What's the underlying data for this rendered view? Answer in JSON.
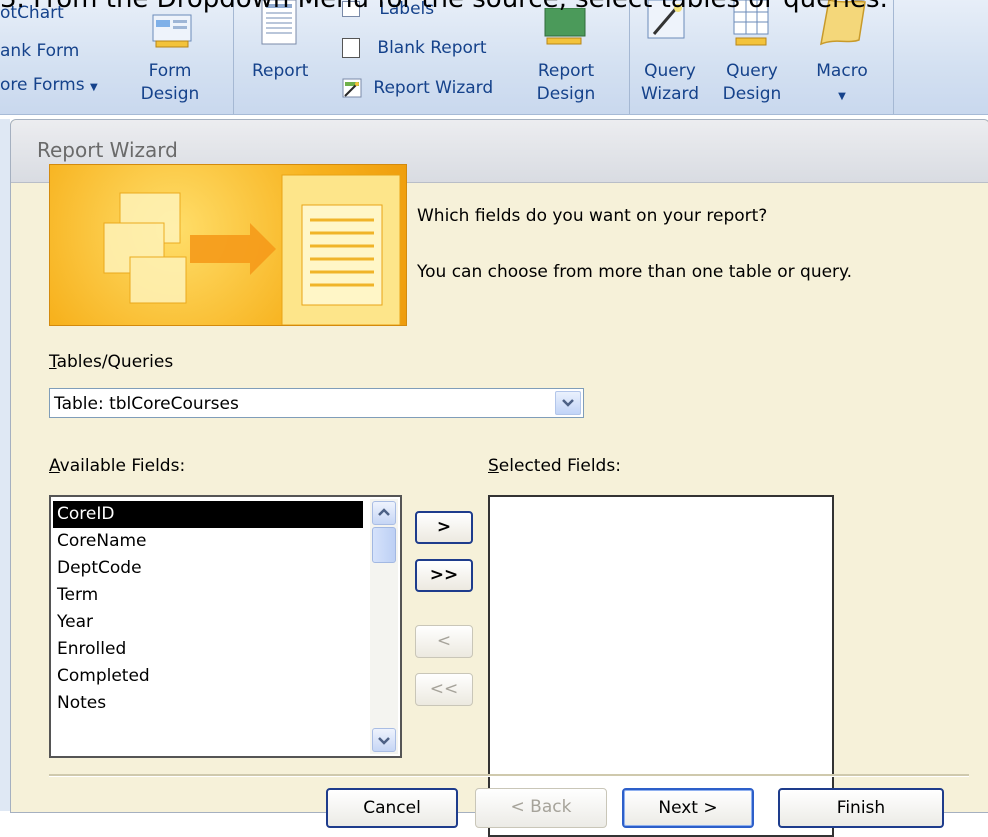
{
  "caption": "3.  From the Dropdown Menu for the source, select tables or queries.",
  "ribbon": {
    "pivotchart_label": "otChart",
    "blank_form_label": "ank Form",
    "more_forms_label": "ore Forms",
    "form_design_line1": "Form",
    "form_design_line2": "Design",
    "report_label": "Report",
    "labels_label": "Labels",
    "blank_report_label": "Blank Report",
    "report_wizard_label": "Report Wizard",
    "report_design_line1": "Report",
    "report_design_line2": "Design",
    "query_wizard_line1": "Query",
    "query_wizard_line2": "Wizard",
    "query_design_line1": "Query",
    "query_design_line2": "Design",
    "macro_label": "Macro"
  },
  "dialog": {
    "title": "Report Wizard",
    "question": "Which fields do you want on your report?",
    "hint": "You can choose from more than one table or query.",
    "tables_label": "Tables/Queries",
    "tables_value": "Table: tblCoreCourses",
    "available_label": "Available Fields:",
    "selected_label": "Selected Fields:",
    "available_fields": [
      "CoreID",
      "CoreName",
      "DeptCode",
      "Term",
      "Year",
      "Enrolled",
      "Completed",
      "Notes"
    ],
    "selected_field_index": 0,
    "move_buttons": {
      "add_one": ">",
      "add_all": ">>",
      "remove_one": "<",
      "remove_all": "<<"
    },
    "footer": {
      "cancel": "Cancel",
      "back": "< Back",
      "next": "Next >",
      "finish": "Finish"
    }
  },
  "colors": {
    "dialog_bg": "#f6f1d9",
    "ribbon_text": "#15428b",
    "banner_orange": "#f7b21e"
  }
}
